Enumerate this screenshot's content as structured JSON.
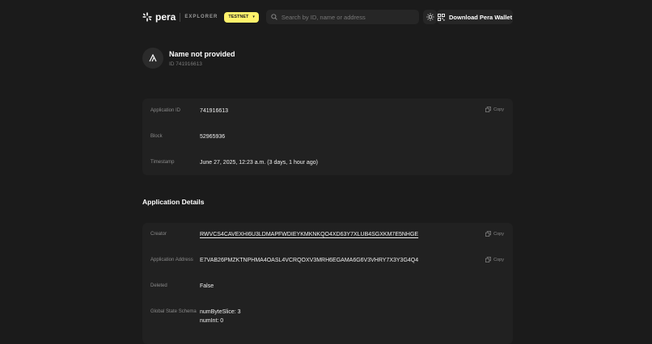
{
  "header": {
    "brand": "pera",
    "product": "EXPLORER",
    "network": "TESTNET",
    "search_placeholder": "Search by ID, name or address",
    "download_label": "Download Pera Wallet",
    "icons": [
      "pera-logo-icon",
      "chevron-down-icon",
      "search-icon",
      "sun-icon",
      "qr-code-icon"
    ]
  },
  "app": {
    "name": "Name not provided",
    "id_text": "ID 741916613"
  },
  "summary": {
    "rows": [
      {
        "label": "Application ID",
        "value": "741916613"
      },
      {
        "label": "Block",
        "value": "52965936"
      },
      {
        "label": "Timestamp",
        "value": "June 27, 2025, 12:23 a.m. (3 days, 1 hour ago)"
      }
    ],
    "copy_label": "Copy"
  },
  "details": {
    "title": "Application Details",
    "rows": [
      {
        "label": "Creator",
        "value": "RWVCS4CAVEXHI6U3LDMAPFWDIEYKMKNKQO4XD63Y7XLUB4SGXKM7E5NHGE"
      },
      {
        "label": "Application Address",
        "value": "E7VAB26PMZKTNPHMA4OASL4VCRQOXV3MRH6EGAMA6G6V3VHRY7X3Y3G4Q4"
      },
      {
        "label": "Deleted",
        "value": "False"
      },
      {
        "label": "Global State Schema",
        "value": "numByteSlice: 3",
        "value2": "numInt: 0"
      }
    ],
    "copy_label": "Copy"
  }
}
